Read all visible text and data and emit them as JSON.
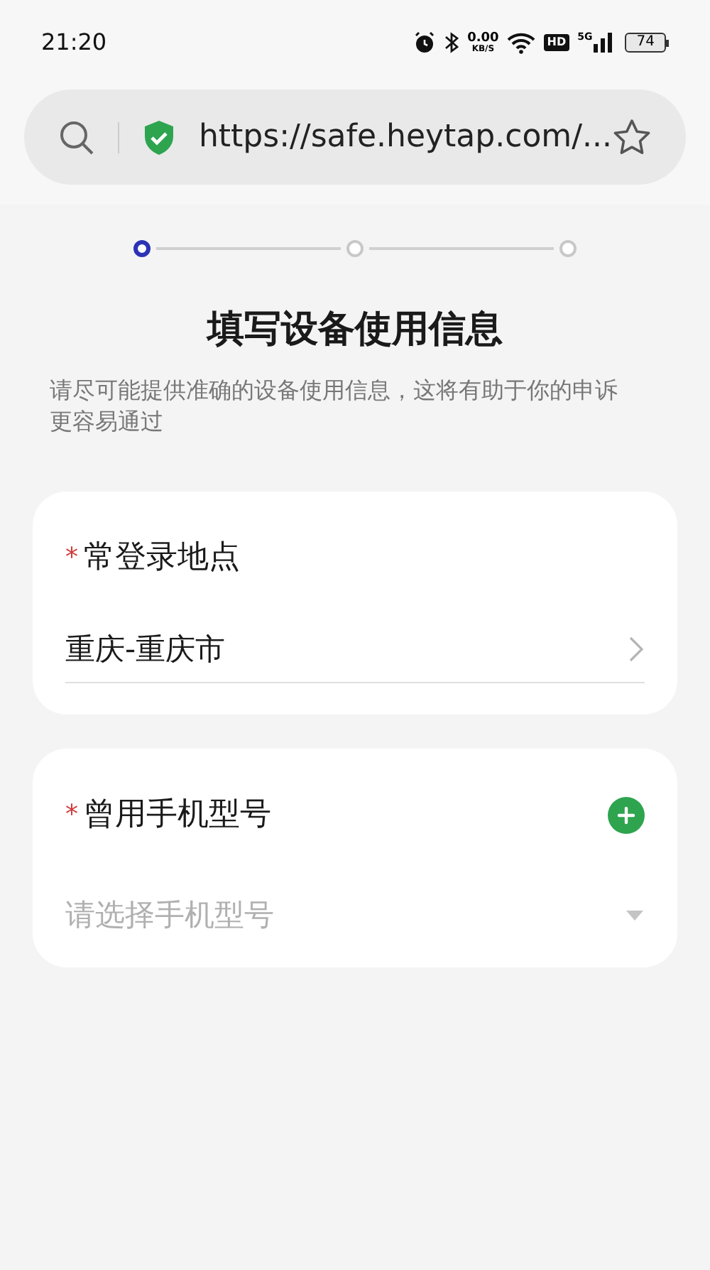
{
  "status_bar": {
    "time": "21:20",
    "speed_value": "0.00",
    "speed_unit": "KB/S",
    "hd": "HD",
    "network": "5G",
    "battery": "74"
  },
  "address_bar": {
    "url": "https://safe.heytap.com/...",
    "secure": true
  },
  "steps": [
    {
      "selected": true
    },
    {
      "selected": false
    },
    {
      "selected": false
    }
  ],
  "title": "填写设备使用信息",
  "description": "请尽可能提供准确的设备使用信息，这将有助于你的申诉更容易通过",
  "fields": [
    {
      "kind": "picker",
      "label": "常登录地点",
      "required_mark": "*",
      "value": "重庆-重庆市"
    },
    {
      "kind": "dropdown",
      "label": "曾用手机型号",
      "required_mark": "*",
      "placeholder": "请选择手机型号",
      "addable": true
    }
  ]
}
